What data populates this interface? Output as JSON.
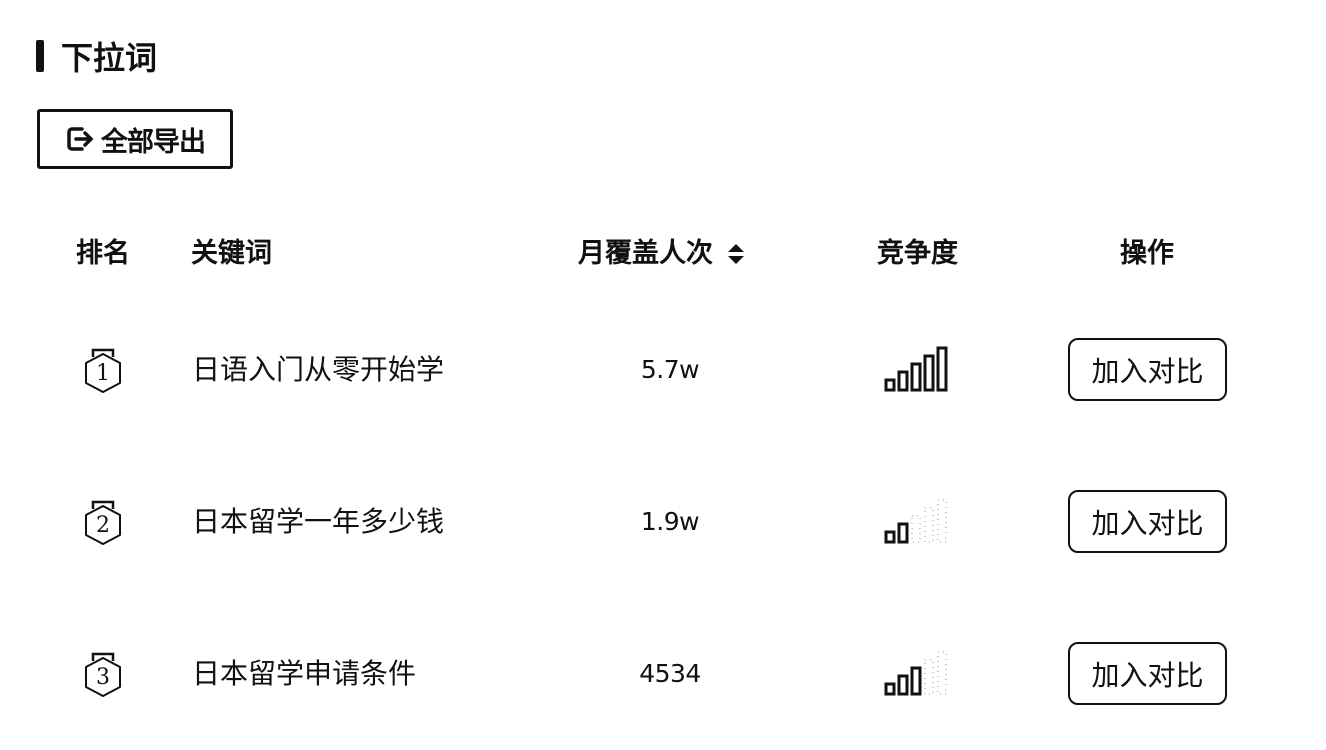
{
  "section": {
    "title": "下拉词"
  },
  "toolbar": {
    "export_label": "全部导出",
    "export_icon": "export-icon"
  },
  "table": {
    "headers": {
      "rank": "排名",
      "keyword": "关键词",
      "coverage": "月覆盖人次",
      "competition": "竞争度",
      "action": "操作"
    },
    "sort_icon": "sort-icon",
    "rows": [
      {
        "rank": "1",
        "keyword": "日语入门从零开始学",
        "coverage": "5.7w",
        "competition_level": 5,
        "competition_max": 5,
        "action_label": "加入对比"
      },
      {
        "rank": "2",
        "keyword": "日本留学一年多少钱",
        "coverage": "1.9w",
        "competition_level": 2,
        "competition_max": 5,
        "action_label": "加入对比"
      },
      {
        "rank": "3",
        "keyword": "日本留学申请条件",
        "coverage": "4534",
        "competition_level": 3,
        "competition_max": 5,
        "action_label": "加入对比"
      }
    ]
  },
  "colors": {
    "text": "#111111",
    "background": "#ffffff"
  }
}
